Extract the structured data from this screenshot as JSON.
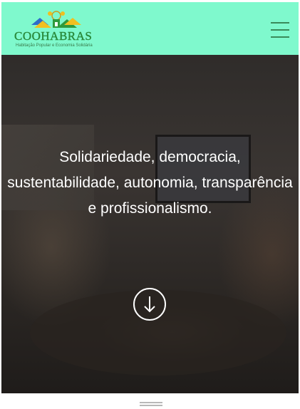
{
  "header": {
    "logo": {
      "name": "COOHABRAS",
      "tagline": "Habitação Popular e Economia Solidária"
    },
    "menu_icon": "hamburger-menu-icon",
    "background": "#7ff9cd"
  },
  "hero": {
    "tagline_lines": [
      "Solidariedade, democracia,",
      "sustentabilidade, autonomia, transparência",
      "e profissionalismo."
    ],
    "scroll_icon": "arrow-down-circle-icon"
  },
  "colors": {
    "accent": "#7ff9cd",
    "logo_green": "#2a8a3c",
    "text_on_hero": "#ffffff"
  }
}
